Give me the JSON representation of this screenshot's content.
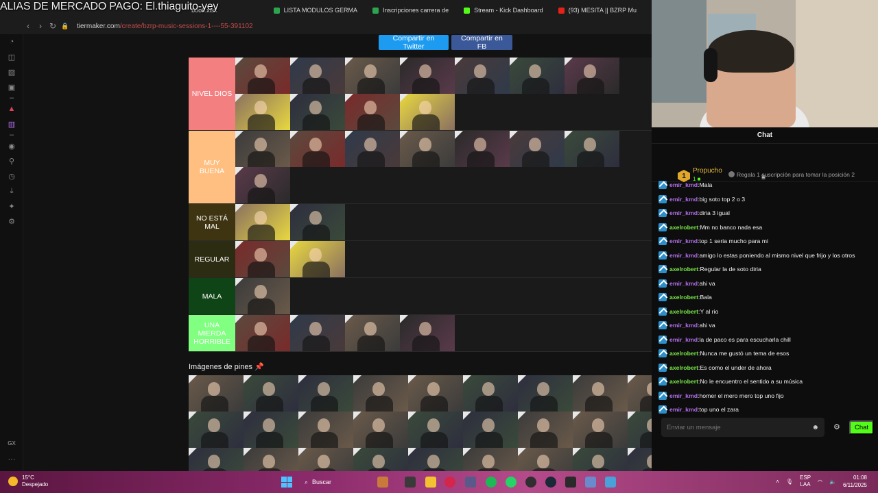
{
  "browser": {
    "overlay_title": "ALIAS DE MERCADO PAGO: El.thiaguito-yey",
    "bookmarks": [
      {
        "label": "LISTA MODULOS GERMA",
        "color": "#2da44e"
      },
      {
        "label": "Inscripciones carrera de",
        "color": "#2da44e"
      },
      {
        "label": "Stream - Kick Dashboard",
        "color": "#53fc18"
      },
      {
        "label": "(93) MESITA || BZRP Mu",
        "color": "#e62117"
      }
    ],
    "partial_bookmark": "book.xlsx",
    "url_host": "tiermaker.com",
    "url_path": "/create/bzrp-music-sessions-1----55-391102"
  },
  "share": {
    "twitter": "Compartir en Twitter",
    "facebook": "Compartir en FB"
  },
  "tiers": [
    {
      "label": "NIVEL DIOS",
      "color": "#f47f80",
      "text": "#ffffff",
      "count": 11
    },
    {
      "label": "MUY BUENA",
      "color": "#ffbf80",
      "text": "#ffffff",
      "count": 8
    },
    {
      "label": "NO ESTÁ MAL",
      "color": "#3f3411",
      "text": "#ffffff",
      "count": 2
    },
    {
      "label": "REGULAR",
      "color": "#2c2c13",
      "text": "#ffffff",
      "count": 2
    },
    {
      "label": "MALA",
      "color": "#0f4416",
      "text": "#ffffff",
      "count": 1
    },
    {
      "label": "UNA MIERDA HORRIBLE",
      "color": "#80ff80",
      "text": "#ffffff",
      "count": 4
    }
  ],
  "pins": {
    "title": "Imágenes de pines 📌",
    "count": 27
  },
  "chat": {
    "header": "Chat",
    "leader_name": "Propucho",
    "leader_rank": "1",
    "leader_sub": "1",
    "leader_note": "Regala 1 suscripción para tomar la posición 2",
    "messages": [
      {
        "user": "emir_kmd",
        "text": "Mala"
      },
      {
        "user": "emir_kmd",
        "text": "big soto top 2 o 3"
      },
      {
        "user": "emir_kmd",
        "text": "diria 3 igual"
      },
      {
        "user": "axelrobert",
        "text": "Mm no banco nada esa"
      },
      {
        "user": "emir_kmd",
        "text": "top 1 seria mucho para mi"
      },
      {
        "user": "emir_kmd",
        "text": "amigo lo estas poniendo al mismo nivel que frijo y los otros"
      },
      {
        "user": "axelrobert",
        "text": "Regular la de soto diria"
      },
      {
        "user": "emir_kmd",
        "text": "ahi va"
      },
      {
        "user": "axelrobert",
        "text": "Bala"
      },
      {
        "user": "axelrobert",
        "text": "Y al rio"
      },
      {
        "user": "emir_kmd",
        "text": "ahi va"
      },
      {
        "user": "emir_kmd",
        "text": "la de paco es para escucharla chill"
      },
      {
        "user": "axelrobert",
        "text": "Nunca me gustó un tema de esos"
      },
      {
        "user": "axelrobert",
        "text": "Es como el under de ahora"
      },
      {
        "user": "axelrobert",
        "text": "No le encuentro el sentido a su música"
      },
      {
        "user": "emir_kmd",
        "text": "homer el mero mero top uno fijo"
      },
      {
        "user": "emir_kmd",
        "text": "top uno el zara"
      }
    ],
    "input_placeholder": "Enviar un mensaje",
    "send_label": "Chat"
  },
  "taskbar": {
    "temp": "15°C",
    "weather": "Despejado",
    "search": "Buscar",
    "lang_top": "ESP",
    "lang_bottom": "LAA",
    "time": "01:08",
    "date": "6/11/2025"
  }
}
